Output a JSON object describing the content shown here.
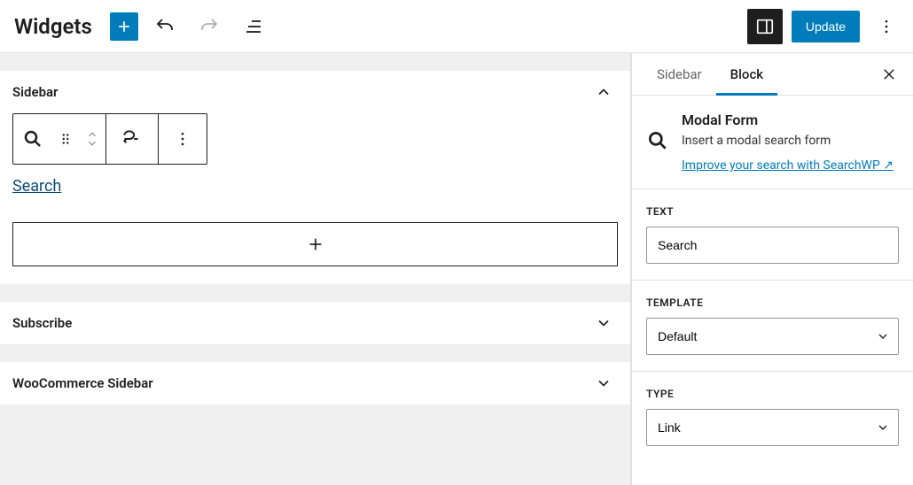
{
  "header": {
    "title": "Widgets",
    "update": "Update"
  },
  "editor": {
    "areas": [
      {
        "title": "Sidebar",
        "expanded": true,
        "hasBlock": true,
        "block": {
          "linkText": "Search"
        }
      },
      {
        "title": "Subscribe",
        "expanded": false
      },
      {
        "title": "WooCommerce Sidebar",
        "expanded": false
      }
    ]
  },
  "inspector": {
    "tabs": {
      "sidebar": "Sidebar",
      "block": "Block",
      "active": "block"
    },
    "block": {
      "name": "Modal Form",
      "description": "Insert a modal search form",
      "linkText": "Improve your search with SearchWP ↗"
    },
    "fields": {
      "text": {
        "label": "TEXT",
        "value": "Search"
      },
      "template": {
        "label": "TEMPLATE",
        "value": "Default"
      },
      "type": {
        "label": "TYPE",
        "value": "Link"
      }
    }
  }
}
